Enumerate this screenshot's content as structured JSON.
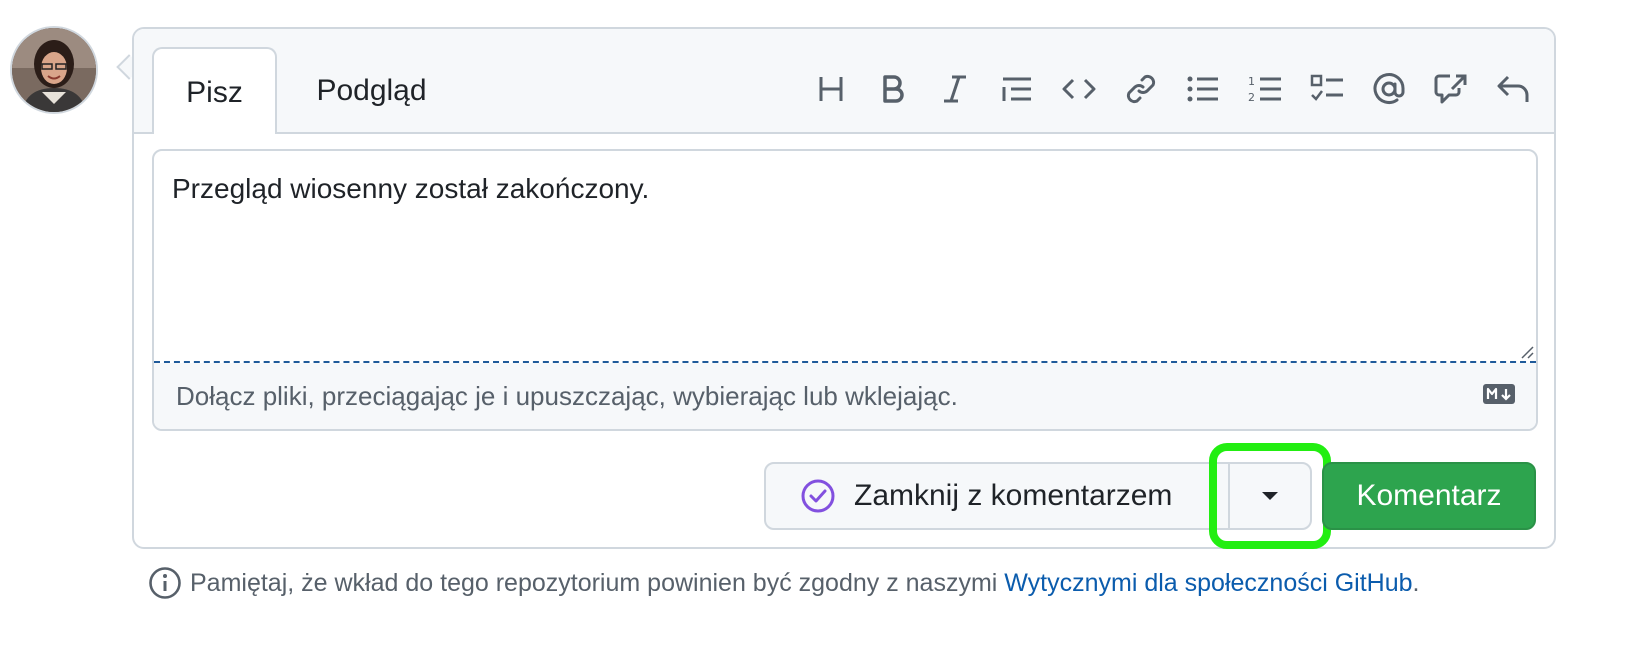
{
  "tabs": {
    "write": "Pisz",
    "preview": "Podgląd"
  },
  "toolbar": {
    "icons": [
      "heading-icon",
      "bold-icon",
      "italic-icon",
      "quote-icon",
      "code-icon",
      "link-icon",
      "bullet-list-icon",
      "numbered-list-icon",
      "task-list-icon",
      "mention-icon",
      "cross-reference-icon",
      "reply-icon"
    ]
  },
  "editor": {
    "value": "Przegląd wiosenny został zakończony.",
    "attach_hint": "Dołącz pliki, przeciągając je i upuszczając, wybierając lub wklejając."
  },
  "actions": {
    "close_label": "Zamknij z komentarzem",
    "comment_label": "Komentarz"
  },
  "note": {
    "text": "Pamiętaj, że wkład do tego repozytorium powinien być zgodny z naszymi",
    "link": "Wytycznymi dla społeczności GitHub",
    "suffix": "."
  },
  "colors": {
    "accent_green": "#2da44e",
    "highlight": "#22ee11",
    "close_icon": "#8250df",
    "link": "#0b5cad"
  }
}
